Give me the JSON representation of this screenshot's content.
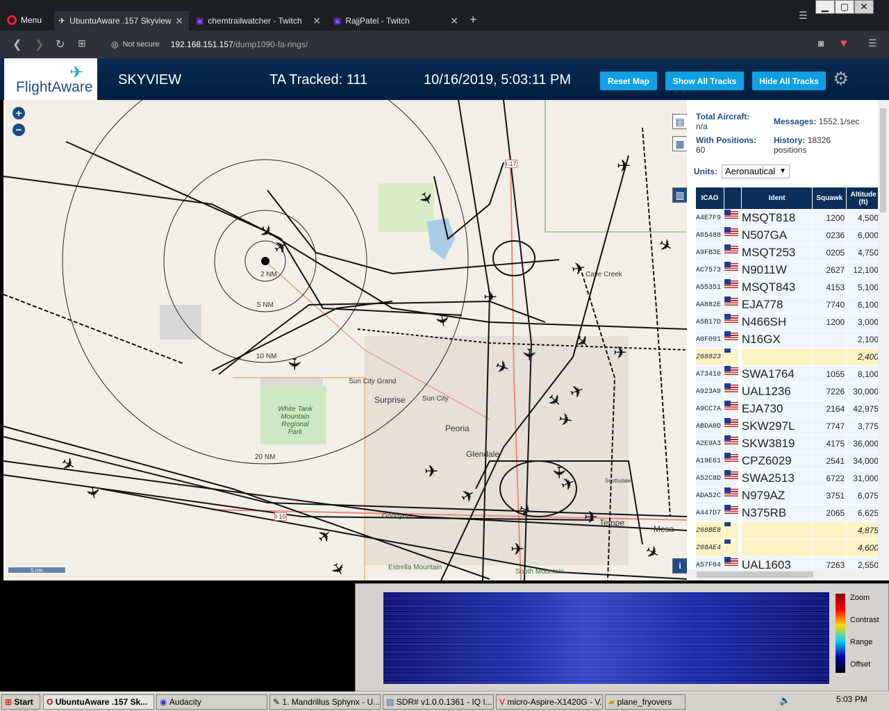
{
  "browser": {
    "menu_label": "Menu",
    "tabs": [
      {
        "title": "UbuntuAware .157 Skyview",
        "active": true
      },
      {
        "title": "chemtrailwatcher - Twitch",
        "active": false
      },
      {
        "title": "RajjPatel - Twitch",
        "active": false
      }
    ],
    "security_label": "Not secure",
    "url_host": "192.168.151.157",
    "url_path": "/dump1090-fa-rings/"
  },
  "header": {
    "logo_text": "FlightAware",
    "app_title": "SKYVIEW",
    "tracked": "TA Tracked: 111",
    "datetime": "10/16/2019, 5:03:11 PM",
    "buttons": [
      "Reset Map",
      "Show All Tracks",
      "Hide All Tracks"
    ],
    "accent_color": "#0ea0e2"
  },
  "stats": {
    "total_label": "Total Aircraft:",
    "total_value": "n/a",
    "positions_label": "With Positions:",
    "positions_value": "60",
    "messages_label": "Messages:",
    "messages_value": "1552.1/sec",
    "history_label": "History:",
    "history_value": "18326",
    "history_unit": "positions",
    "units_label": "Units:",
    "units_value": "Aeronautical"
  },
  "table": {
    "columns": [
      "ICAO",
      "",
      "Ident",
      "Squawk",
      "Altitude (ft)"
    ],
    "rows": [
      {
        "icao": "A4E7F9",
        "ident": "MSQT818",
        "squawk": "1200",
        "alt": "4,500",
        "flag": true
      },
      {
        "icao": "A65488",
        "ident": "N507GA",
        "squawk": "0236",
        "alt": "6,000",
        "flag": true
      },
      {
        "icao": "A9FB3E",
        "ident": "MSQT253",
        "squawk": "0205",
        "alt": "4,750",
        "flag": true
      },
      {
        "icao": "AC7573",
        "ident": "N9011W",
        "squawk": "2627",
        "alt": "12,100",
        "flag": true
      },
      {
        "icao": "A55351",
        "ident": "MSQT843",
        "squawk": "4153",
        "alt": "5,100",
        "flag": true
      },
      {
        "icao": "AA882E",
        "ident": "EJA778",
        "squawk": "7740",
        "alt": "6,100",
        "flag": true
      },
      {
        "icao": "A5B17D",
        "ident": "N466SH",
        "squawk": "1200",
        "alt": "3,000",
        "flag": true
      },
      {
        "icao": "A0F001",
        "ident": "N16GX",
        "squawk": "",
        "alt": "2,100",
        "flag": true
      },
      {
        "icao": "268823",
        "ident": "",
        "squawk": "",
        "alt": "2,400",
        "flag": false,
        "highlight": true
      },
      {
        "icao": "A73410",
        "ident": "SWA1764",
        "squawk": "1055",
        "alt": "8,100",
        "flag": true
      },
      {
        "icao": "A923A9",
        "ident": "UAL1236",
        "squawk": "7226",
        "alt": "30,000",
        "flag": true
      },
      {
        "icao": "A9CC7A",
        "ident": "EJA730",
        "squawk": "2164",
        "alt": "42,975",
        "flag": true
      },
      {
        "icao": "ABDA0D",
        "ident": "SKW297L",
        "squawk": "7747",
        "alt": "3,775",
        "flag": true
      },
      {
        "icao": "A2E9A3",
        "ident": "SKW3819",
        "squawk": "4175",
        "alt": "36,000",
        "flag": true
      },
      {
        "icao": "A19E61",
        "ident": "CPZ6029",
        "squawk": "2541",
        "alt": "34,000",
        "flag": true
      },
      {
        "icao": "A52C8D",
        "ident": "SWA2513",
        "squawk": "6722",
        "alt": "31,000",
        "flag": true
      },
      {
        "icao": "ADA52C",
        "ident": "N979AZ",
        "squawk": "3751",
        "alt": "6,075",
        "flag": true
      },
      {
        "icao": "A447D7",
        "ident": "N375RB",
        "squawk": "2065",
        "alt": "6,625",
        "flag": true
      },
      {
        "icao": "268BE8",
        "ident": "",
        "squawk": "",
        "alt": "4,875",
        "flag": false,
        "highlight": true
      },
      {
        "icao": "268AE4",
        "ident": "",
        "squawk": "",
        "alt": "4,600",
        "flag": false,
        "highlight": true
      },
      {
        "icao": "A57F04",
        "ident": "UAL1603",
        "squawk": "7263",
        "alt": "2,550",
        "flag": true
      }
    ]
  },
  "map": {
    "range_labels": [
      "2 NM",
      "5 NM",
      "10 NM",
      "20 NM"
    ],
    "place_labels": [
      "Cave Creek",
      "Sun City Grand",
      "Surprise",
      "Sun City",
      "Peoria",
      "Glendale",
      "Goodyear",
      "Tempe",
      "Mesa",
      "Scottsdale",
      "White Tank Mountain Regional Park",
      "Estrella Mountain",
      "South Mountain"
    ],
    "scale_label": "5 nm",
    "road_labels": [
      "I-17",
      "I-10"
    ]
  },
  "sdr": {
    "labels": [
      "Zoom",
      "Contrast",
      "Range",
      "Offset"
    ]
  },
  "taskbar": {
    "start": "Start",
    "items": [
      "UbuntuAware .157 Sk...",
      "Audacity",
      "1. Mandrillus Sphynx - U...",
      "SDR# v1.0.0.1361 - IQ I...",
      "micro-Aspire-X1420G - V...",
      "plane_fryovers"
    ],
    "clock": "5:03 PM"
  }
}
